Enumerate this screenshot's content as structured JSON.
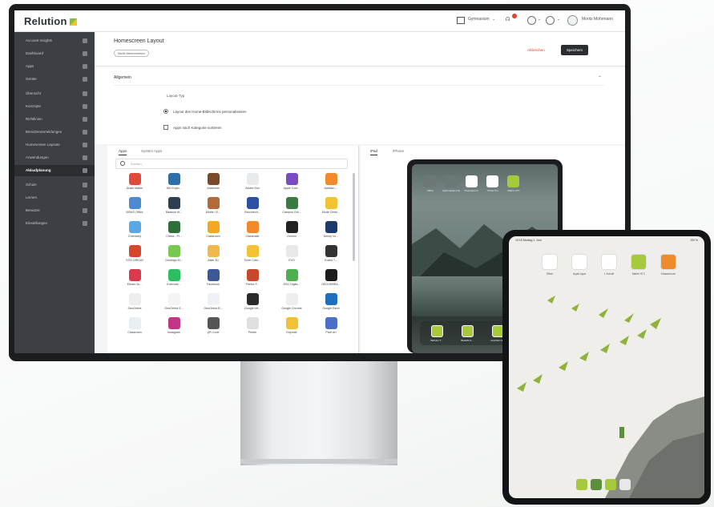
{
  "topbar": {
    "logo": "Relution",
    "org": "Gymnasium",
    "notifications": "1",
    "user": "Moritz Mohrmann"
  },
  "sidebar": {
    "items": [
      {
        "label": "Account Insights"
      },
      {
        "label": "Dashboard"
      },
      {
        "label": "Apps"
      },
      {
        "label": "Geräte"
      },
      {
        "label": "Übersicht"
      },
      {
        "label": "Konzepte"
      },
      {
        "label": "Richtlinien"
      },
      {
        "label": "Benutzeranmeldungen"
      },
      {
        "label": "Homescreen Layouts"
      },
      {
        "label": "Anwendungen"
      },
      {
        "label": "Ablaufplanung"
      },
      {
        "label": "Schule"
      },
      {
        "label": "Lernen"
      },
      {
        "label": "Benutzer"
      },
      {
        "label": "Einstellungen"
      }
    ]
  },
  "header": {
    "title": "Homescreen Layout",
    "chip": "Nicht übernommen",
    "cancel": "Abbrechen",
    "save": "Speichern"
  },
  "settings": {
    "section_title": "Allgemein",
    "layout_type_label": "Layout-Typ",
    "option_personal": "Layout des Home-Bildschirms personalisieren",
    "option_category": "Apps nach Kategorie sortieren"
  },
  "apps_panel": {
    "tabs": [
      "Apps",
      "System Apps"
    ],
    "search_placeholder": "Suchen",
    "apps": [
      {
        "label": "Duale Mathe",
        "color": "#e04a3c"
      },
      {
        "label": "360 Explo...",
        "color": "#2e6fa8"
      },
      {
        "label": "Anatomie",
        "color": "#7a4a2a"
      },
      {
        "label": "Adobe Doc",
        "color": "#e9eaeb"
      },
      {
        "label": "Apple Conf...",
        "color": "#7b4bc4"
      },
      {
        "label": "Addition ...",
        "color": "#f08a2a"
      },
      {
        "label": "MSKO Office",
        "color": "#4d8bd1"
      },
      {
        "label": "Balance M...",
        "color": "#2c3e50"
      },
      {
        "label": "Moritz / E...",
        "color": "#b36a38"
      },
      {
        "label": "Bruchrech...",
        "color": "#2d4fa3"
      },
      {
        "label": "Campus Ont...",
        "color": "#3a7b44"
      },
      {
        "label": "Mode Chem...",
        "color": "#f1c232"
      },
      {
        "label": "Chemistry",
        "color": "#5aa9e6"
      },
      {
        "label": "Chess - Pl...",
        "color": "#2f6f3a"
      },
      {
        "label": "Classroom",
        "color": "#f5a623"
      },
      {
        "label": "Classmate",
        "color": "#f08a2a"
      },
      {
        "label": "Gemini",
        "color": "#222222"
      },
      {
        "label": "Deezy Vo...",
        "color": "#1e3a6b"
      },
      {
        "label": "DSS ORIGIN",
        "color": "#d9452c"
      },
      {
        "label": "Duolingo M...",
        "color": "#78c850"
      },
      {
        "label": "Atlas 3D",
        "color": "#f2b84b"
      },
      {
        "label": "Euler Cam...",
        "color": "#f1c232"
      },
      {
        "label": "EVO",
        "color": "#e8e8e8"
      },
      {
        "label": "Euklid T...",
        "color": "#333333"
      },
      {
        "label": "Elearn Sc...",
        "color": "#d93a4c"
      },
      {
        "label": "Evernote...",
        "color": "#2dbe60"
      },
      {
        "label": "Facebook",
        "color": "#3b5998"
      },
      {
        "label": "Firefox F...",
        "color": "#c64a2a"
      },
      {
        "label": "DSC Digita...",
        "color": "#4caf50"
      },
      {
        "label": "GEOGEBRA...",
        "color": "#1b1b1b"
      },
      {
        "label": "GeoGebra",
        "color": "#eeeeee"
      },
      {
        "label": "GeoGebra S...",
        "color": "#f4f4f4"
      },
      {
        "label": "GeoGebra B...",
        "color": "#eef1f5"
      },
      {
        "label": "Google Art...",
        "color": "#2b2b2b"
      },
      {
        "label": "Google Chrome",
        "color": "#eeeeee"
      },
      {
        "label": "Google Earth",
        "color": "#1f6fbf"
      },
      {
        "label": "Classroom",
        "color": "#e8f0f4"
      },
      {
        "label": "Instagram",
        "color": "#c13584"
      },
      {
        "label": "QR Code",
        "color": "#555555"
      },
      {
        "label": "Printer",
        "color": "#e0e0e0"
      },
      {
        "label": "Keynote",
        "color": "#f1c232"
      },
      {
        "label": "Pixel Art",
        "color": "#4a6fc4"
      }
    ]
  },
  "preview": {
    "tabs": [
      "iPad",
      "iPhone"
    ],
    "home_apps": [
      {
        "label": "Office",
        "color": "#6b7876"
      },
      {
        "label": "Apple Apple-Frei",
        "color": "#6b7876"
      },
      {
        "label": "Pixelmator P...",
        "color": "#ffffff"
      },
      {
        "label": "Photo Pro",
        "color": "#ffffff"
      },
      {
        "label": "Mathe HTC",
        "color": "#a7c93c"
      }
    ],
    "dock_apps": [
      {
        "label": "Ball der T..."
      },
      {
        "label": "Bewähr A..."
      },
      {
        "label": "Anschein d..."
      }
    ]
  },
  "ipad": {
    "status_left": "10:15 Montag 1. Juni",
    "status_right": "100 %",
    "home_apps": [
      {
        "label": "Office",
        "color": "#ffffff"
      },
      {
        "label": "Apple Apps",
        "color": "#ffffff"
      },
      {
        "label": "1 Schule",
        "color": "#ffffff"
      },
      {
        "label": "Mathe HTC",
        "color": "#a7c93c"
      },
      {
        "label": "Klassenbuch",
        "color": "#f08a2a"
      }
    ],
    "dock_colors": [
      "#a7c93c",
      "#5b8f3e",
      "#a7c93c",
      "#e8e8e8"
    ]
  },
  "colors": {
    "accent": "#d9452c",
    "sidebar_bg": "#3c3f43",
    "brand_green": "#7fbf3f"
  }
}
